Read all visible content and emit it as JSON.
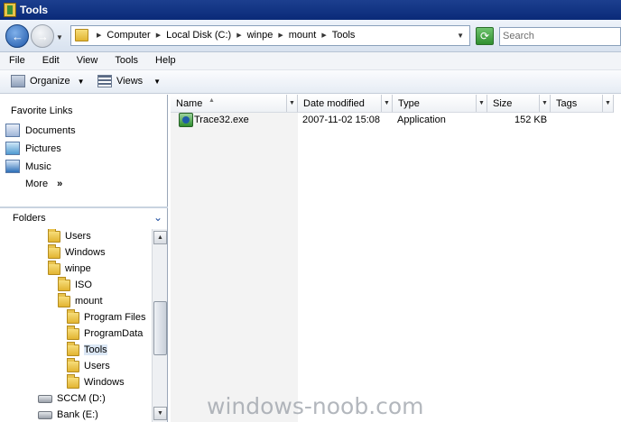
{
  "window": {
    "title": "Tools"
  },
  "address": {
    "crumbs": [
      "Computer",
      "Local Disk (C:)",
      "winpe",
      "mount",
      "Tools"
    ],
    "search_placeholder": "Search"
  },
  "menu": [
    "File",
    "Edit",
    "View",
    "Tools",
    "Help"
  ],
  "toolbar": {
    "organize": "Organize",
    "views": "Views"
  },
  "favorites": {
    "title": "Favorite Links",
    "items": [
      {
        "label": "Documents",
        "icon": "documents-icon"
      },
      {
        "label": "Pictures",
        "icon": "pictures-icon"
      },
      {
        "label": "Music",
        "icon": "music-icon"
      }
    ],
    "more": "More",
    "more_chevron": "»"
  },
  "folders": {
    "title": "Folders",
    "tree": [
      {
        "label": "Users",
        "type": "folder"
      },
      {
        "label": "Windows",
        "type": "folder"
      },
      {
        "label": "winpe",
        "type": "folder"
      },
      {
        "label": "ISO",
        "type": "folder"
      },
      {
        "label": "mount",
        "type": "folder"
      },
      {
        "label": "Program Files",
        "type": "folder"
      },
      {
        "label": "ProgramData",
        "type": "folder"
      },
      {
        "label": "Tools",
        "type": "folder",
        "selected": true
      },
      {
        "label": "Users",
        "type": "folder"
      },
      {
        "label": "Windows",
        "type": "folder"
      },
      {
        "label": "SCCM (D:)",
        "type": "drive"
      },
      {
        "label": "Bank (E:)",
        "type": "drive"
      }
    ]
  },
  "columns": [
    "Name",
    "Date modified",
    "Type",
    "Size",
    "Tags"
  ],
  "files": [
    {
      "name": "Trace32.exe",
      "date_modified": "2007-11-02 15:08",
      "type": "Application",
      "size": "152 KB",
      "tags": ""
    }
  ],
  "watermark": "windows-noob.com"
}
